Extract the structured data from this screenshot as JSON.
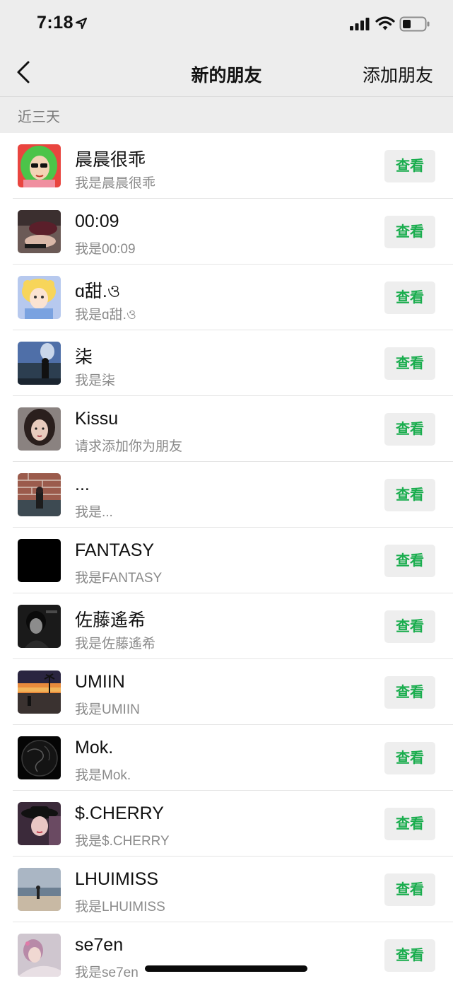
{
  "status_bar": {
    "time": "7:18"
  },
  "nav": {
    "title": "新的朋友",
    "action": "添加朋友"
  },
  "section": {
    "label": "近三天"
  },
  "rows": [
    {
      "name": "晨晨很乖",
      "sub": "我是晨晨很乖",
      "button": "查看",
      "avatar": "cartoon-green-hair-avatar"
    },
    {
      "name": "00:09",
      "sub": "我是00:09",
      "button": "查看",
      "avatar": "photo-avatar"
    },
    {
      "name": "ɑ甜.ও",
      "sub": "我是ɑ甜.ও",
      "button": "查看",
      "avatar": "anime-girl-avatar"
    },
    {
      "name": "柒",
      "sub": "我是柒",
      "button": "查看",
      "avatar": "city-view-avatar"
    },
    {
      "name": "Kissu",
      "sub": "请求添加你为朋友",
      "button": "查看",
      "avatar": "portrait-avatar"
    },
    {
      "name": "...",
      "sub": "我是...",
      "button": "查看",
      "avatar": "brick-wall-avatar"
    },
    {
      "name": "FANTASY",
      "sub": "我是FANTASY",
      "button": "查看",
      "avatar": "black-avatar"
    },
    {
      "name": "佐藤遙希",
      "sub": "我是佐藤遙希",
      "button": "查看",
      "avatar": "bw-portrait-avatar"
    },
    {
      "name": "UMIIN",
      "sub": "我是UMIIN",
      "button": "查看",
      "avatar": "sunset-avatar"
    },
    {
      "name": "Mok.",
      "sub": "我是Mok.",
      "button": "查看",
      "avatar": "dark-globe-avatar"
    },
    {
      "name": "$.CHERRY",
      "sub": "我是$.CHERRY",
      "button": "查看",
      "avatar": "hat-portrait-avatar"
    },
    {
      "name": "LHUIMISS",
      "sub": "我是LHUIMISS",
      "button": "查看",
      "avatar": "beach-avatar"
    },
    {
      "name": "se7en",
      "sub": "我是se7en",
      "button": "查看",
      "avatar": "pastel-portrait-avatar"
    }
  ],
  "colors": {
    "accent_green": "#1aad4e",
    "background": "#ededed",
    "button_bg": "#eeeeee",
    "secondary_text": "#8a8a8a"
  }
}
